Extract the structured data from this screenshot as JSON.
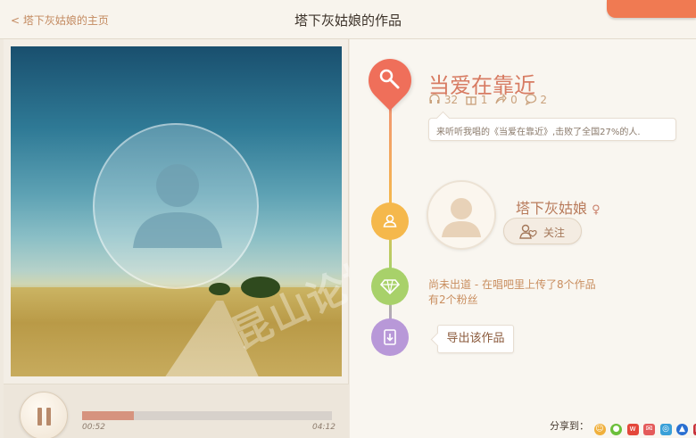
{
  "header": {
    "back_link": "< 塔下灰姑娘的主页",
    "title": "塔下灰姑娘的作品"
  },
  "player": {
    "current_time": "00:52",
    "total_time": "04:12",
    "progress_percent": 20.6
  },
  "song": {
    "title": "当爱在靠近",
    "listens": "32",
    "gifts": "1",
    "shares": "0",
    "comments": "2",
    "bubble_text": "来听听我唱的《当爱在靠近》,击败了全国27%的人."
  },
  "user": {
    "name": "塔下灰姑娘",
    "gender_icon": "female-icon",
    "follow_label": "关注"
  },
  "info": {
    "line1": "尚未出道 - 在唱吧里上传了8个作品",
    "line2": "有2个粉丝"
  },
  "export": {
    "label": "导出该作品"
  },
  "share": {
    "label": "分享到："
  },
  "watermark": "昆山论坛 BBS KUNSHAN",
  "colors": {
    "accent": "#ef6f5a",
    "yellow": "#f5b84c",
    "green": "#a8d16a",
    "purple": "#b898d8"
  }
}
